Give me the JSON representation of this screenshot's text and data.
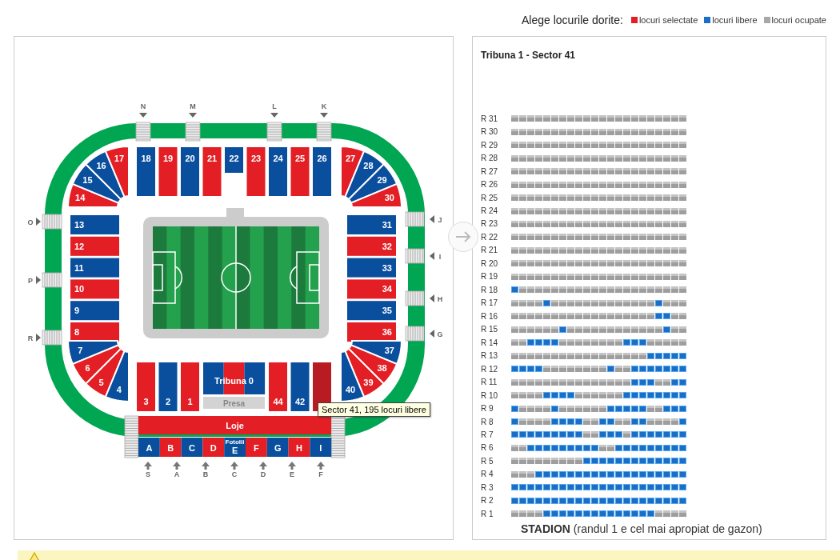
{
  "legend": {
    "prompt": "Alege locurile dorite:",
    "items": [
      {
        "label": "locuri selectate",
        "color": "#e31e24"
      },
      {
        "label": "locuri libere",
        "color": "#1a6fc4"
      },
      {
        "label": "locuri ocupate",
        "color": "#a8a8a8"
      }
    ]
  },
  "stadium": {
    "gates_top": [
      "N",
      "M",
      "L",
      "K"
    ],
    "gates_left": [
      "O",
      "P",
      "R"
    ],
    "gates_right": [
      "J",
      "I",
      "H",
      "G"
    ],
    "gates_bottom": [
      "S",
      "A",
      "B",
      "C",
      "D",
      "E",
      "F"
    ],
    "sectors_top": [
      {
        "label": "18",
        "color": "#0a4f9e"
      },
      {
        "label": "19",
        "color": "#e31e24"
      },
      {
        "label": "20",
        "color": "#0a4f9e"
      },
      {
        "label": "21",
        "color": "#e31e24"
      },
      {
        "label": "22",
        "color": "#0a4f9e"
      },
      {
        "label": "23",
        "color": "#e31e24"
      },
      {
        "label": "24",
        "color": "#0a4f9e"
      },
      {
        "label": "25",
        "color": "#e31e24"
      },
      {
        "label": "26",
        "color": "#0a4f9e"
      }
    ],
    "corner_top_left": [
      {
        "label": "14",
        "color": "#e31e24"
      },
      {
        "label": "15",
        "color": "#0a4f9e"
      },
      {
        "label": "16",
        "color": "#0a4f9e"
      },
      {
        "label": "17",
        "color": "#e31e24"
      }
    ],
    "corner_top_right": [
      {
        "label": "27",
        "color": "#e31e24"
      },
      {
        "label": "28",
        "color": "#0a4f9e"
      },
      {
        "label": "29",
        "color": "#0a4f9e"
      },
      {
        "label": "30",
        "color": "#e31e24"
      }
    ],
    "sectors_left": [
      {
        "label": "13",
        "color": "#0a4f9e"
      },
      {
        "label": "12",
        "color": "#e31e24"
      },
      {
        "label": "11",
        "color": "#0a4f9e"
      },
      {
        "label": "10",
        "color": "#e31e24"
      },
      {
        "label": "9",
        "color": "#0a4f9e"
      },
      {
        "label": "8",
        "color": "#e31e24"
      }
    ],
    "sectors_right": [
      {
        "label": "31",
        "color": "#0a4f9e"
      },
      {
        "label": "32",
        "color": "#e31e24"
      },
      {
        "label": "33",
        "color": "#0a4f9e"
      },
      {
        "label": "34",
        "color": "#e31e24"
      },
      {
        "label": "35",
        "color": "#0a4f9e"
      },
      {
        "label": "36",
        "color": "#e31e24"
      }
    ],
    "corner_bottom_left": [
      {
        "label": "7",
        "color": "#0a4f9e"
      },
      {
        "label": "6",
        "color": "#e31e24"
      },
      {
        "label": "5",
        "color": "#e31e24"
      },
      {
        "label": "4",
        "color": "#0a4f9e"
      }
    ],
    "corner_bottom_right": [
      {
        "label": "37",
        "color": "#0a4f9e"
      },
      {
        "label": "38",
        "color": "#e31e24"
      },
      {
        "label": "39",
        "color": "#e31e24"
      },
      {
        "label": "40",
        "color": "#0a4f9e"
      }
    ],
    "sectors_bottom_left": [
      {
        "label": "3",
        "color": "#e31e24"
      },
      {
        "label": "2",
        "color": "#0a4f9e"
      },
      {
        "label": "1",
        "color": "#e31e24"
      }
    ],
    "sectors_bottom_right": [
      {
        "label": "44",
        "color": "#e31e24"
      },
      {
        "label": "42",
        "color": "#0a4f9e"
      },
      {
        "color": "#b81c22"
      }
    ],
    "tribuna_0": {
      "label": "Tribuna 0",
      "parts": [
        {
          "color": "#0a4f9e"
        },
        {
          "color": "#e31e24"
        },
        {
          "color": "#0a4f9e"
        }
      ],
      "press": "Presa"
    },
    "loje": {
      "label": "Loje",
      "color": "#e31e24"
    },
    "fotolii": {
      "label": "Fotolii",
      "seats": [
        {
          "label": "A",
          "color": "#0a4f9e"
        },
        {
          "label": "B",
          "color": "#e31e24"
        },
        {
          "label": "C",
          "color": "#0a4f9e"
        },
        {
          "label": "D",
          "color": "#e31e24"
        },
        {
          "label": "E",
          "color": "#0a4f9e"
        },
        {
          "label": "F",
          "color": "#e31e24"
        },
        {
          "label": "G",
          "color": "#0a4f9e"
        },
        {
          "label": "H",
          "color": "#e31e24"
        },
        {
          "label": "I",
          "color": "#0a4f9e"
        }
      ]
    },
    "tooltip": "Sector 41, 195 locuri libere"
  },
  "seat_map": {
    "title": "Tribuna 1 - Sector 41",
    "caption": "**STADION** (randul 1 e cel mai apropiat de gazon)",
    "rows": [
      {
        "label": "R 31",
        "free": [
          false,
          false,
          false,
          false,
          false,
          false,
          false,
          false,
          false,
          false,
          false,
          false,
          false,
          false,
          false,
          false,
          false,
          false,
          false,
          false,
          false,
          false
        ]
      },
      {
        "label": "R 30",
        "free": [
          false,
          false,
          false,
          false,
          false,
          false,
          false,
          false,
          false,
          false,
          false,
          false,
          false,
          false,
          false,
          false,
          false,
          false,
          false,
          false,
          false,
          false
        ]
      },
      {
        "label": "R 29",
        "free": [
          false,
          false,
          false,
          false,
          false,
          false,
          false,
          false,
          false,
          false,
          false,
          false,
          false,
          false,
          false,
          false,
          false,
          false,
          false,
          false,
          false,
          false
        ]
      },
      {
        "label": "R 28",
        "free": [
          false,
          false,
          false,
          false,
          false,
          false,
          false,
          false,
          false,
          false,
          false,
          false,
          false,
          false,
          false,
          false,
          false,
          false,
          false,
          false,
          false,
          false
        ]
      },
      {
        "label": "R 27",
        "free": [
          false,
          false,
          false,
          false,
          false,
          false,
          false,
          false,
          false,
          false,
          false,
          false,
          false,
          false,
          false,
          false,
          false,
          false,
          false,
          false,
          false,
          false
        ]
      },
      {
        "label": "R 26",
        "free": [
          false,
          false,
          false,
          false,
          false,
          false,
          false,
          false,
          false,
          false,
          false,
          false,
          false,
          false,
          false,
          false,
          false,
          false,
          false,
          false,
          false,
          false
        ]
      },
      {
        "label": "R 25",
        "free": [
          false,
          false,
          false,
          false,
          false,
          false,
          false,
          false,
          false,
          false,
          false,
          false,
          false,
          false,
          false,
          false,
          false,
          false,
          false,
          false,
          false,
          false
        ]
      },
      {
        "label": "R 24",
        "free": [
          false,
          false,
          false,
          false,
          false,
          false,
          false,
          false,
          false,
          false,
          false,
          false,
          false,
          false,
          false,
          false,
          false,
          false,
          false,
          false,
          false,
          false
        ]
      },
      {
        "label": "R 23",
        "free": [
          false,
          false,
          false,
          false,
          false,
          false,
          false,
          false,
          false,
          false,
          false,
          false,
          false,
          false,
          false,
          false,
          false,
          false,
          false,
          false,
          false,
          false
        ]
      },
      {
        "label": "R 22",
        "free": [
          false,
          false,
          false,
          false,
          false,
          false,
          false,
          false,
          false,
          false,
          false,
          false,
          false,
          false,
          false,
          false,
          false,
          false,
          false,
          false,
          false,
          false
        ]
      },
      {
        "label": "R 21",
        "free": [
          false,
          false,
          false,
          false,
          false,
          false,
          false,
          false,
          false,
          false,
          false,
          false,
          false,
          false,
          false,
          false,
          false,
          false,
          false,
          false,
          false,
          false
        ]
      },
      {
        "label": "R 20",
        "free": [
          false,
          false,
          false,
          false,
          false,
          false,
          false,
          false,
          false,
          false,
          false,
          false,
          false,
          false,
          false,
          false,
          false,
          false,
          false,
          false,
          false,
          false
        ]
      },
      {
        "label": "R 19",
        "free": [
          false,
          false,
          false,
          false,
          false,
          false,
          false,
          false,
          false,
          false,
          false,
          false,
          false,
          false,
          false,
          false,
          false,
          false,
          false,
          false,
          false,
          false
        ]
      },
      {
        "label": "R 18",
        "free": [
          true,
          false,
          false,
          false,
          false,
          false,
          false,
          false,
          false,
          false,
          false,
          false,
          false,
          false,
          false,
          false,
          false,
          false,
          false,
          false,
          false,
          false
        ]
      },
      {
        "label": "R 17",
        "free": [
          false,
          false,
          false,
          false,
          true,
          false,
          false,
          false,
          false,
          false,
          false,
          false,
          false,
          false,
          false,
          false,
          false,
          false,
          true,
          false,
          false,
          false
        ]
      },
      {
        "label": "R 16",
        "free": [
          false,
          false,
          false,
          false,
          false,
          false,
          false,
          false,
          false,
          false,
          false,
          false,
          false,
          false,
          false,
          false,
          false,
          false,
          true,
          true,
          false,
          false
        ]
      },
      {
        "label": "R 15",
        "free": [
          false,
          false,
          false,
          false,
          false,
          false,
          true,
          false,
          false,
          false,
          false,
          false,
          false,
          false,
          false,
          false,
          false,
          false,
          false,
          true,
          false,
          false
        ]
      },
      {
        "label": "R 14",
        "free": [
          false,
          false,
          true,
          true,
          true,
          true,
          false,
          false,
          false,
          false,
          false,
          false,
          false,
          false,
          true,
          true,
          true,
          false,
          false,
          false,
          false,
          false
        ]
      },
      {
        "label": "R 13",
        "free": [
          false,
          false,
          false,
          false,
          false,
          false,
          false,
          false,
          false,
          false,
          false,
          false,
          false,
          false,
          false,
          false,
          false,
          true,
          true,
          true,
          true,
          true
        ]
      },
      {
        "label": "R 12",
        "free": [
          true,
          true,
          true,
          true,
          false,
          false,
          false,
          false,
          false,
          false,
          false,
          false,
          true,
          false,
          false,
          true,
          true,
          true,
          true,
          true,
          true,
          true
        ]
      },
      {
        "label": "R 11",
        "free": [
          false,
          false,
          false,
          false,
          false,
          false,
          false,
          false,
          false,
          false,
          false,
          false,
          false,
          false,
          false,
          true,
          true,
          true,
          false,
          false,
          true,
          true
        ]
      },
      {
        "label": "R 10",
        "free": [
          false,
          false,
          false,
          false,
          true,
          true,
          true,
          true,
          false,
          false,
          false,
          false,
          false,
          false,
          true,
          true,
          true,
          true,
          true,
          true,
          true,
          true
        ]
      },
      {
        "label": "R 9",
        "free": [
          true,
          false,
          false,
          false,
          false,
          true,
          false,
          false,
          false,
          false,
          false,
          false,
          true,
          true,
          true,
          true,
          true,
          false,
          false,
          true,
          true,
          true
        ]
      },
      {
        "label": "R 8",
        "free": [
          true,
          false,
          false,
          false,
          false,
          true,
          true,
          true,
          true,
          false,
          false,
          true,
          true,
          false,
          false,
          true,
          true,
          false,
          false,
          false,
          false,
          true
        ]
      },
      {
        "label": "R 7",
        "free": [
          true,
          true,
          true,
          true,
          true,
          true,
          true,
          true,
          true,
          false,
          false,
          true,
          true,
          true,
          false,
          true,
          true,
          true,
          true,
          true,
          true,
          true
        ]
      },
      {
        "label": "R 6",
        "free": [
          false,
          false,
          true,
          true,
          true,
          true,
          true,
          true,
          true,
          true,
          true,
          false,
          false,
          true,
          true,
          true,
          true,
          true,
          true,
          true,
          true,
          true
        ]
      },
      {
        "label": "R 5",
        "free": [
          false,
          false,
          false,
          false,
          false,
          false,
          false,
          false,
          false,
          true,
          true,
          true,
          true,
          true,
          true,
          true,
          true,
          true,
          true,
          true,
          true,
          true
        ]
      },
      {
        "label": "R 4",
        "free": [
          false,
          false,
          false,
          true,
          true,
          true,
          true,
          true,
          true,
          true,
          true,
          true,
          true,
          true,
          true,
          true,
          true,
          true,
          true,
          true,
          true,
          true
        ]
      },
      {
        "label": "R 3",
        "free": [
          true,
          true,
          true,
          true,
          true,
          true,
          true,
          true,
          true,
          true,
          true,
          true,
          true,
          true,
          true,
          true,
          true,
          true,
          true,
          true,
          true,
          true
        ]
      },
      {
        "label": "R 2",
        "free": [
          true,
          true,
          true,
          true,
          true,
          true,
          true,
          true,
          true,
          true,
          true,
          true,
          true,
          true,
          true,
          true,
          true,
          true,
          true,
          true,
          true,
          true
        ]
      },
      {
        "label": "R 1",
        "free": [
          false,
          false,
          false,
          false,
          true,
          true,
          true,
          true,
          true,
          true,
          true,
          true,
          true,
          true,
          true,
          true,
          true,
          true,
          false,
          false,
          false,
          false
        ]
      }
    ]
  }
}
